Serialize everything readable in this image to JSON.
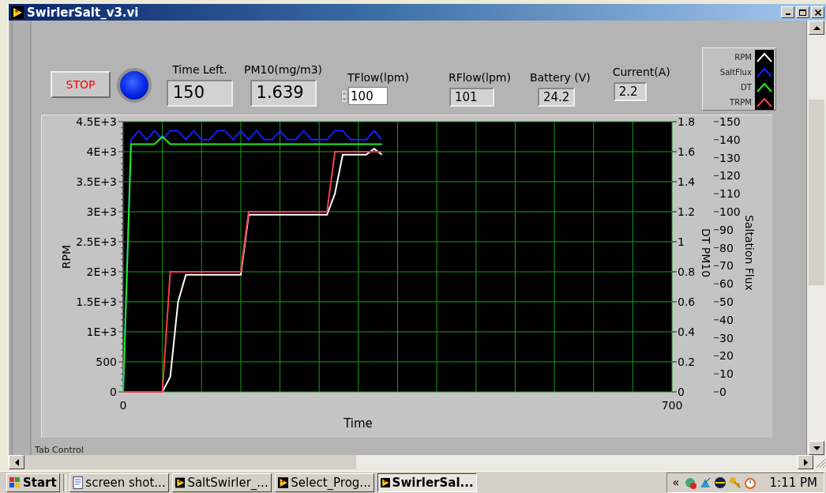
{
  "window": {
    "title": "SwirlerSalt_v3.vi"
  },
  "controls": [
    {
      "kind": "button",
      "label": "STOP"
    },
    {
      "kind": "led",
      "on": true
    },
    {
      "kind": "big_indicator",
      "label": "Time Left.",
      "value": "150"
    },
    {
      "kind": "big_indicator",
      "label": "PM10(mg/m3)",
      "value": "1.639"
    },
    {
      "kind": "numeric_control",
      "label": "TFlow(lpm)",
      "value": "100"
    },
    {
      "kind": "indicator",
      "label": "RFlow(lpm)",
      "value": "101"
    },
    {
      "kind": "indicator",
      "label": "Battery (V)",
      "value": "24.2"
    },
    {
      "kind": "indicator",
      "label": "Current(A)",
      "value": "2.2"
    }
  ],
  "chart_data": {
    "type": "line",
    "xlabel": "Time",
    "ylabel": "RPM",
    "xlim": [
      0,
      700
    ],
    "ylim": [
      0,
      4500
    ],
    "xticks": [
      0,
      700
    ],
    "grid": true,
    "legend": "upper right",
    "yticks": [
      {
        "value": 0,
        "label": "0"
      },
      {
        "value": 500,
        "label": "500"
      },
      {
        "value": 1000,
        "label": "1E+3"
      },
      {
        "value": 1500,
        "label": "1.5E+3"
      },
      {
        "value": 2000,
        "label": "2E+3"
      },
      {
        "value": 2500,
        "label": "2.5E+3"
      },
      {
        "value": 3000,
        "label": "3E+3"
      },
      {
        "value": 3500,
        "label": "3.5E+3"
      },
      {
        "value": 4000,
        "label": "4E+3"
      },
      {
        "value": 4500,
        "label": "4.5E+3"
      }
    ],
    "y2label": "DT PM10",
    "y2lim": [
      0,
      1.8
    ],
    "y2ticks": [
      0,
      0.2,
      0.4,
      0.6,
      0.8,
      1,
      1.2,
      1.4,
      1.6,
      1.8
    ],
    "y3label": "Saltation Flux",
    "y3lim": [
      0,
      150
    ],
    "y3ticks": [
      0,
      10,
      20,
      30,
      40,
      50,
      60,
      70,
      80,
      90,
      100,
      110,
      120,
      130,
      140,
      150
    ],
    "x": [
      0,
      10,
      20,
      30,
      40,
      50,
      60,
      70,
      80,
      90,
      100,
      110,
      120,
      130,
      140,
      150,
      160,
      170,
      180,
      190,
      200,
      210,
      220,
      230,
      240,
      250,
      260,
      270,
      280,
      290,
      300,
      310,
      320,
      330
    ],
    "series": [
      {
        "name": "RPM",
        "color": "#ffffff",
        "values": [
          0,
          0,
          0,
          0,
          0,
          0,
          250,
          1500,
          1950,
          1950,
          1950,
          1950,
          1950,
          1950,
          1950,
          1950,
          2950,
          2950,
          2950,
          2950,
          2950,
          2950,
          2950,
          2950,
          2950,
          2950,
          2950,
          3300,
          3950,
          3950,
          3950,
          3950,
          4050,
          3950
        ]
      },
      {
        "name": "SaltFlux",
        "color": "#1020ff",
        "axis": "y3",
        "values": [
          0,
          140,
          145,
          140,
          145,
          140,
          145,
          145,
          140,
          145,
          140,
          140,
          145,
          145,
          140,
          145,
          140,
          145,
          140,
          140,
          145,
          140,
          140,
          145,
          140,
          140,
          140,
          145,
          145,
          140,
          140,
          140,
          145,
          140
        ]
      },
      {
        "name": "DT",
        "color": "#20f020",
        "axis": "y2",
        "values": [
          0,
          1.65,
          1.65,
          1.65,
          1.65,
          1.7,
          1.65,
          1.65,
          1.65,
          1.65,
          1.65,
          1.65,
          1.65,
          1.65,
          1.65,
          1.65,
          1.65,
          1.65,
          1.65,
          1.65,
          1.65,
          1.65,
          1.65,
          1.65,
          1.65,
          1.65,
          1.65,
          1.65,
          1.65,
          1.65,
          1.65,
          1.65,
          1.65,
          1.65
        ]
      },
      {
        "name": "TRPM",
        "color": "#f04050",
        "values": [
          0,
          0,
          0,
          0,
          0,
          0,
          2000,
          2000,
          2000,
          2000,
          2000,
          2000,
          2000,
          2000,
          2000,
          2000,
          3000,
          3000,
          3000,
          3000,
          3000,
          3000,
          3000,
          3000,
          3000,
          3000,
          3000,
          4000,
          4000,
          4000,
          4000,
          4000,
          4000,
          4000
        ]
      }
    ]
  },
  "tab_control": {
    "label": "Tab Control"
  },
  "taskbar": {
    "start": "Start",
    "tasks": [
      {
        "label": "screen shot...",
        "kind": "document",
        "selected": false
      },
      {
        "label": "SaltSwirler_...",
        "kind": "labview",
        "selected": false
      },
      {
        "label": "Select_Prog...",
        "kind": "labview",
        "selected": false
      },
      {
        "label": "SwirlerSal...",
        "kind": "labview",
        "selected": true
      }
    ],
    "tray_toggle": "«",
    "clock": "1:11 PM"
  }
}
